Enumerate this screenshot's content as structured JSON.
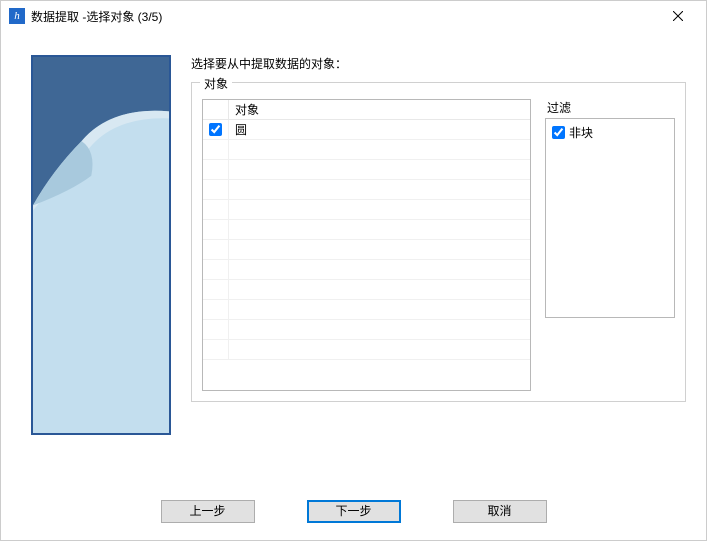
{
  "window": {
    "title": "数据提取 -选择对象 (3/5)"
  },
  "instruction": "选择要从中提取数据的对象：",
  "groupbox_label": "对象",
  "objects": {
    "header": "对象",
    "rows": [
      {
        "checked": true,
        "name": "圆"
      }
    ]
  },
  "filter": {
    "label": "过滤",
    "items": [
      {
        "checked": true,
        "name": "非块"
      }
    ]
  },
  "buttons": {
    "back": "上一步",
    "next": "下一步",
    "cancel": "取消"
  }
}
